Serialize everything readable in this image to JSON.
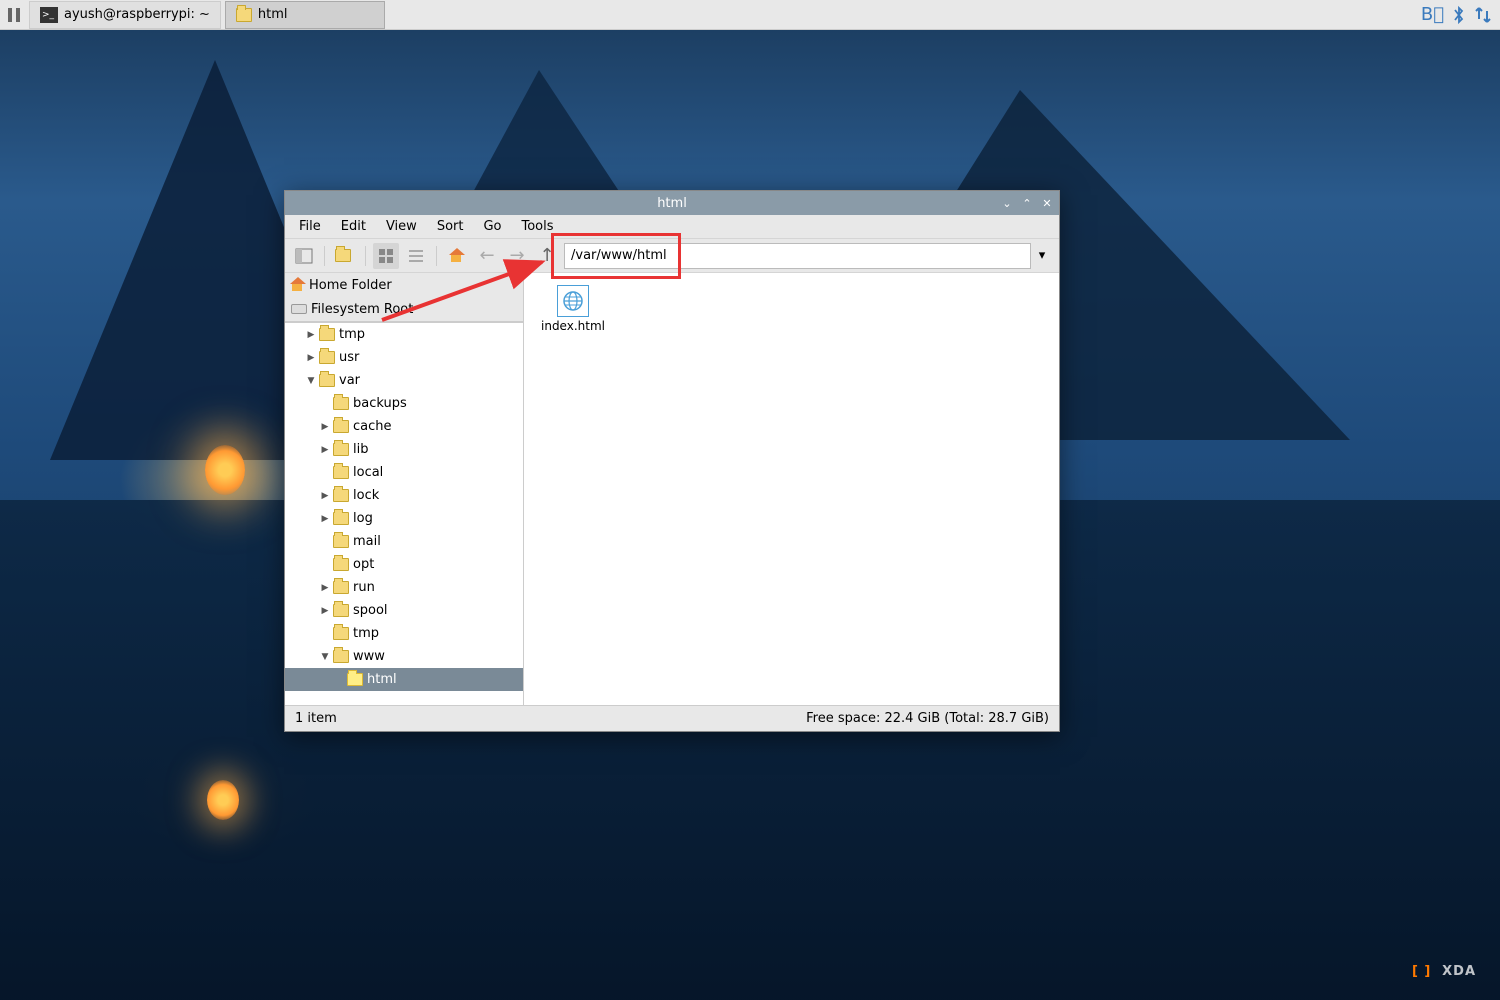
{
  "taskbar": {
    "terminal_task": "ayush@raspberrypi: ~",
    "fm_task": "html"
  },
  "window": {
    "title": "html",
    "menu": {
      "file": "File",
      "edit": "Edit",
      "view": "View",
      "sort": "Sort",
      "go": "Go",
      "tools": "Tools"
    },
    "path": "/var/www/html",
    "places": {
      "home": "Home Folder",
      "root": "Filesystem Root"
    },
    "tree": {
      "tmp": "tmp",
      "usr": "usr",
      "var": "var",
      "backups": "backups",
      "cache": "cache",
      "lib": "lib",
      "local": "local",
      "lock": "lock",
      "log": "log",
      "mail": "mail",
      "opt": "opt",
      "run": "run",
      "spool": "spool",
      "vartmp": "tmp",
      "www": "www",
      "html": "html"
    },
    "files": {
      "index": "index.html"
    },
    "status_left": "1 item",
    "status_right": "Free space: 22.4 GiB (Total: 28.7 GiB)"
  },
  "watermark": "XDA"
}
